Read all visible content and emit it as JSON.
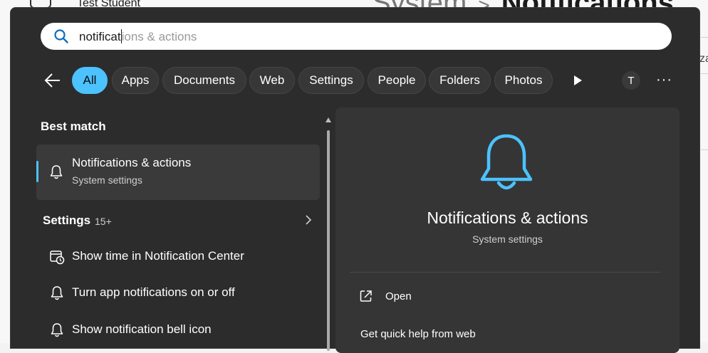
{
  "background": {
    "user_name": "Test Student",
    "breadcrumb_parent": "System",
    "breadcrumb_separator": ">",
    "breadcrumb_current": "Notifications",
    "side_text": "za"
  },
  "search": {
    "typed": "notificat",
    "suggestion": "ions & actions"
  },
  "filters": {
    "chips": [
      "All",
      "Apps",
      "Documents",
      "Web",
      "Settings",
      "People",
      "Folders",
      "Photos"
    ],
    "active": "All",
    "avatar_letter": "T",
    "more": "···"
  },
  "results": {
    "best_match_heading": "Best match",
    "best_match": {
      "title": "Notifications & actions",
      "subtitle": "System settings"
    },
    "settings_heading": "Settings",
    "settings_count": "15+",
    "settings_items": [
      {
        "label": "Show time in Notification Center",
        "icon": "calendar-clock-icon"
      },
      {
        "label": "Turn app notifications on or off",
        "icon": "bell-icon"
      },
      {
        "label": "Show notification bell icon",
        "icon": "bell-icon"
      }
    ]
  },
  "preview": {
    "title": "Notifications & actions",
    "subtitle": "System settings",
    "open_label": "Open",
    "help_label": "Get quick help from web"
  },
  "colors": {
    "accent": "#4cc2ff",
    "flyout_bg": "#2c2c2c",
    "preview_bg": "#353535"
  }
}
